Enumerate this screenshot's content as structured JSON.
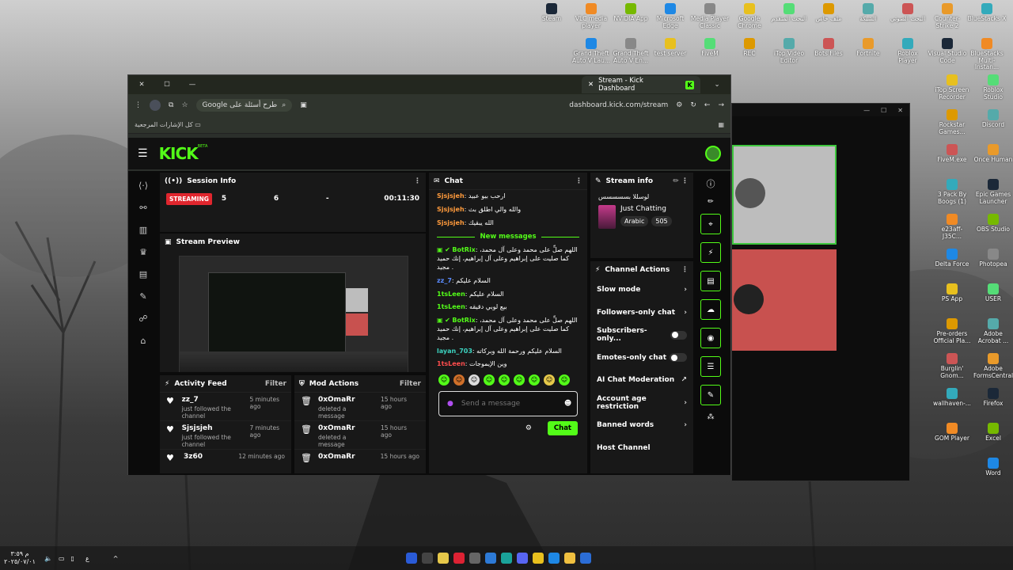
{
  "desktop": {
    "icons_top": [
      "Steam",
      "VLC media player",
      "NVIDIA App",
      "Microsoft Edge",
      "Media Player Classic",
      "Google Chrome",
      "البحث المتقدم",
      "ملف خاص",
      "الشبكة",
      "البحث الصوتي",
      "Counter-Strike 2",
      "BlueStacks X"
    ],
    "icons_row2": [
      "Grand Theft Auto V Lau...",
      "Grand Theft Auto V En...",
      "test server",
      "FiveM",
      "REC",
      "iTop Video Editor",
      "Bots Files",
      "Fortnite",
      "Roblox Player",
      "Visual Studio Code",
      "BlueStacks Multi-Instan..."
    ],
    "icons_right": [
      "iTop Screen Recorder",
      "Roblox Studio",
      "Rockstar Games...",
      "Discord",
      "FiveM.exe",
      "Once Human",
      "3 Pack By Boogs (1)",
      "Epic Games Launcher",
      "e23aff-J35C...",
      "OBS Studio",
      "Delta Force",
      "Photopea",
      "PS App",
      "USER",
      "Pre-orders Official Pla...",
      "Adobe Acrobat ...",
      "Burglin' Gnom...",
      "Adobe FormsCentral",
      "wallhaven-...",
      "Firefox",
      "GOM Player",
      "Excel",
      "Word"
    ],
    "clock_time": "م ٣:٥٩",
    "clock_date": "٢٠٢٥/٠٧/٠١",
    "lang": "ع"
  },
  "browser": {
    "tab_title": "Stream - Kick Dashboard",
    "search_pill": "Google طرح أسئلة على",
    "url": "dashboard.kick.com/stream",
    "bookmarks_label": "كل الإشارات المرجعية"
  },
  "kick": {
    "logo": "KICK",
    "beta": "BETA",
    "session": {
      "title": "Session Info",
      "status": "STREAMING",
      "viewers": "5",
      "followers": "6",
      "subs": "-",
      "duration": "00:11:30"
    },
    "preview_title": "Stream Preview",
    "activity": {
      "title": "Activity Feed",
      "filter": "Filter",
      "items": [
        {
          "name": "zz_7",
          "sub": "just followed the channel",
          "time": "5 minutes ago"
        },
        {
          "name": "Sjsjsjeh",
          "sub": "just followed the channel",
          "time": "7 minutes ago"
        },
        {
          "name": "3z60",
          "sub": "",
          "time": "12 minutes ago"
        }
      ]
    },
    "mod": {
      "title": "Mod Actions",
      "filter": "Filter",
      "items": [
        {
          "name": "0xOmaRr",
          "sub": "deleted a message",
          "time": "15 hours ago"
        },
        {
          "name": "0xOmaRr",
          "sub": "deleted a message",
          "time": "15 hours ago"
        },
        {
          "name": "0xOmaRr",
          "sub": "",
          "time": "15 hours ago"
        }
      ]
    },
    "chat": {
      "title": "Chat",
      "old": [
        {
          "user": "Sjsjsjeh",
          "color": "#ff9a3c",
          "text": "ارحب بيو عبيد"
        },
        {
          "user": "Sjsjsjeh",
          "color": "#ff9a3c",
          "text": "والله والي اطلق بث"
        },
        {
          "user": "Sjsjsjeh",
          "color": "#ff9a3c",
          "text": "الله يبقيك"
        }
      ],
      "new_label": "New messages",
      "new": [
        {
          "user": "BotRix",
          "color": "#53fc18",
          "text": "اللهم صلِّ على محمد وعلى آل محمد، كما صليت على إبراهيم وعلى آل إبراهيم، إنك حميد مجيد ."
        },
        {
          "user": "zz_7",
          "color": "#5b8cff",
          "text": "السلام عليكم"
        },
        {
          "user": "1tsLeen",
          "color": "#53fc18",
          "text": "السلام عليكم"
        },
        {
          "user": "1tsLeen",
          "color": "#53fc18",
          "text": "بيع لوبي دقيقه"
        },
        {
          "user": "BotRix",
          "color": "#53fc18",
          "text": "اللهم صلِّ على محمد وعلى آل محمد، كما صليت على إبراهيم وعلى آل إبراهيم، إنك حميد مجيد ."
        },
        {
          "user": "layan_703",
          "color": "#3cd3c0",
          "text": "السلام عليكم ورحمة الله وبركاته"
        },
        {
          "user": "1tsLeen",
          "color": "#ff4d4d",
          "text": "وين الإيموجات"
        }
      ],
      "placeholder": "Send a message",
      "send": "Chat"
    },
    "stream_info": {
      "title": "Stream info",
      "stream_title": "لوسللا بسسسسس",
      "category": "Just Chatting",
      "language": "Arabic",
      "count": "505"
    },
    "channel_actions": {
      "title": "Channel Actions",
      "items": [
        {
          "label": "Slow mode",
          "kind": "arrow"
        },
        {
          "label": "Followers-only chat",
          "kind": "arrow"
        },
        {
          "label": "Subscribers-only...",
          "kind": "toggle"
        },
        {
          "label": "Emotes-only chat",
          "kind": "toggle"
        },
        {
          "label": "AI Chat Moderation",
          "kind": "external"
        },
        {
          "label": "Account age restriction",
          "kind": "arrow"
        },
        {
          "label": "Banned words",
          "kind": "arrow"
        },
        {
          "label": "Host Channel",
          "kind": "none"
        }
      ]
    }
  }
}
